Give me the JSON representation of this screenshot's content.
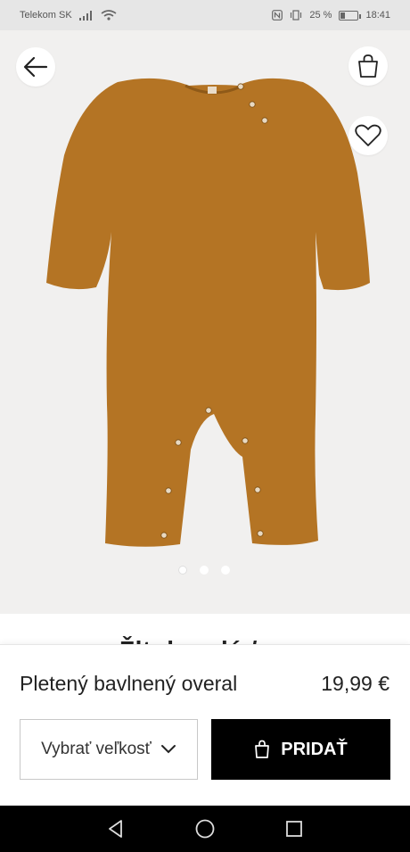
{
  "status_bar": {
    "carrier": "Telekom SK",
    "battery_percent": "25 %",
    "battery_level": 0.25,
    "time": "18:41"
  },
  "product": {
    "name": "Pletený bavlnený overal",
    "price": "19,99 €",
    "color_hex": "#B47424",
    "partial_heading": "Žltohnedá / vzor"
  },
  "gallery": {
    "image_count": 3,
    "active_index": 0
  },
  "actions": {
    "size_label": "Vybrať veľkosť",
    "add_label": "PRIDAŤ"
  },
  "icons": {
    "back": "arrow-left-icon",
    "bag": "shopping-bag-icon",
    "wishlist": "heart-icon",
    "dropdown": "chevron-down-icon",
    "nav_back": "triangle-back-icon",
    "nav_home": "circle-home-icon",
    "nav_recents": "square-recents-icon"
  }
}
